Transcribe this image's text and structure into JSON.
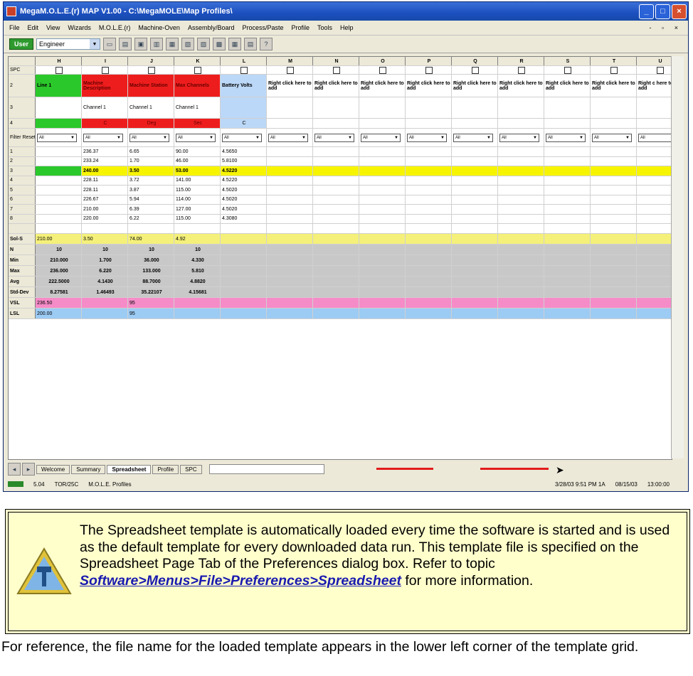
{
  "window": {
    "title": "MegaM.O.L.E.(r) MAP V1.00 - C:\\MegaMOLE\\Map Profiles\\",
    "menu": [
      "File",
      "Edit",
      "View",
      "Wizards",
      "M.O.L.E.(r)",
      "Machine-Oven",
      "Assembly/Board",
      "Process/Paste",
      "Profile",
      "Tools",
      "Help"
    ],
    "win_controls": "- ▫ ×",
    "user_button": "User",
    "user_combo": "Engineer"
  },
  "grid": {
    "columns": [
      "H",
      "I",
      "J",
      "K",
      "L",
      "M",
      "N",
      "O",
      "P",
      "Q",
      "R",
      "S",
      "T",
      "U"
    ],
    "rows": {
      "spc_label": "SPC",
      "r2_label": "2",
      "r2_cells": [
        "Line 1",
        "Machine Description",
        "Machine Station",
        "Max Channels",
        "Battery Volts",
        "Right click here to add",
        "Right click here to add",
        "Right click here to add",
        "Right click here to add",
        "Right click here to add",
        "Right click here to add",
        "Right click here to add",
        "Right click here to add",
        "Right c here to add"
      ],
      "r3_label": "3",
      "r3_cells": [
        "",
        "Channel 1",
        "Channel 1",
        "Channel 1",
        "",
        "",
        "",
        "",
        "",
        "",
        "",
        "",
        "",
        ""
      ],
      "r4_label": "4",
      "r4_cells": [
        "",
        "C",
        "Deg",
        "Sec",
        "C",
        "",
        "",
        "",
        "",
        "",
        "",
        "",
        "",
        ""
      ],
      "filter_label": "Filter Reset",
      "filter_value": "All",
      "data": [
        {
          "label": "1",
          "cells": [
            "",
            "236.37",
            "6.65",
            "90.00",
            "4.5650"
          ]
        },
        {
          "label": "2",
          "cells": [
            "",
            "233.24",
            "1.70",
            "46.00",
            "5.8100"
          ]
        },
        {
          "label": "3",
          "cells": [
            "",
            "240.00",
            "3.50",
            "53.00",
            "4.5220"
          ]
        },
        {
          "label": "4",
          "cells": [
            "",
            "228.11",
            "3.72",
            "141.00",
            "4.5220"
          ]
        },
        {
          "label": "5",
          "cells": [
            "",
            "228.11",
            "3.87",
            "115.00",
            "4.5020"
          ]
        },
        {
          "label": "6",
          "cells": [
            "",
            "226.67",
            "5.94",
            "114.00",
            "4.5020"
          ]
        },
        {
          "label": "7",
          "cells": [
            "",
            "210.00",
            "6.39",
            "127.00",
            "4.5020"
          ]
        },
        {
          "label": "8",
          "cells": [
            "",
            "220.00",
            "6.22",
            "115.00",
            "4.3080"
          ]
        }
      ],
      "stats": [
        {
          "label": "Sol-S",
          "cells": [
            "210.00",
            "3.50",
            "74.00",
            "4.92"
          ]
        },
        {
          "label": "N",
          "cells": [
            "10",
            "10",
            "10",
            "10"
          ]
        },
        {
          "label": "Min",
          "cells": [
            "210.000",
            "1.700",
            "36.000",
            "4.330"
          ]
        },
        {
          "label": "Max",
          "cells": [
            "236.000",
            "6.220",
            "133.000",
            "5.810"
          ]
        },
        {
          "label": "Avg",
          "cells": [
            "222.5000",
            "4.1430",
            "88.7000",
            "4.8820"
          ]
        },
        {
          "label": "Std-Dev",
          "cells": [
            "8.27581",
            "1.46493",
            "35.22107",
            "4.15681"
          ]
        },
        {
          "label": "VSL",
          "cells": [
            "236.50",
            "",
            "95",
            "",
            ""
          ]
        },
        {
          "label": "LSL",
          "cells": [
            "200.00",
            "",
            "95",
            "",
            ""
          ]
        }
      ]
    }
  },
  "bottom": {
    "tabs": [
      "Welcome",
      "Summary",
      "Spreadsheet",
      "Profile",
      "SPC"
    ],
    "status": [
      "5.04",
      "TOR/25C",
      "M.O.L.E. Profiles",
      "3/28/03 9:51 PM 1A",
      "08/15/03",
      "13:00:00"
    ]
  },
  "note": {
    "text1": "The Spreadsheet    template is automatically loaded every time the software is started and is used as the default template for every downloaded data run. This template file is specified on the Spreadsheet Page Tab of the Preferences dialog box. Refer to topic",
    "link": "Software>Menus>File>Preferences>Spreadsheet",
    "text2": " for more information."
  },
  "footer": "For reference, the file name for the loaded template appears in the lower left corner of the template grid."
}
